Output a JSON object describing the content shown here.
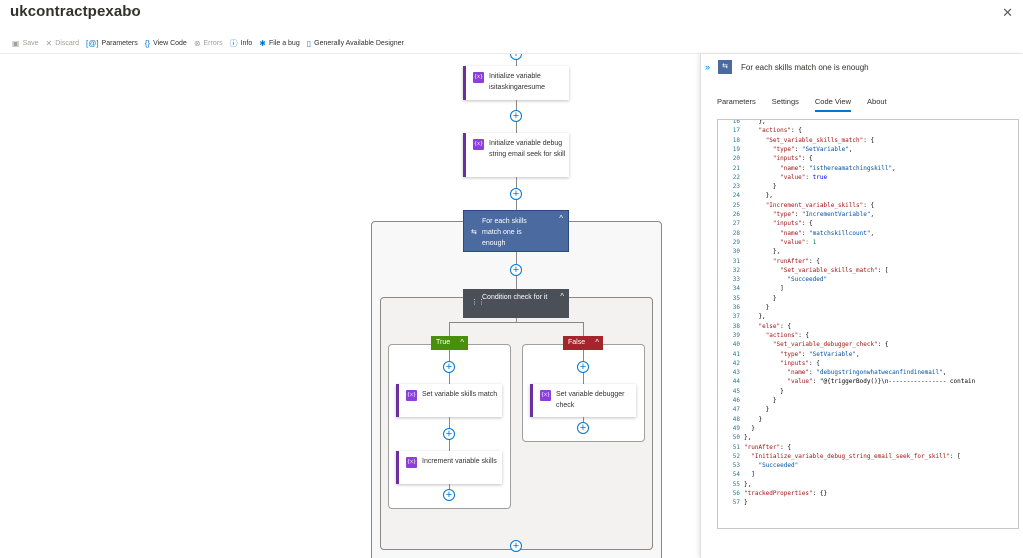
{
  "app": {
    "title": "ukcontractpexabo",
    "more": "···",
    "close": "✕"
  },
  "toolbar": {
    "items": [
      {
        "label": "Save",
        "icon": "save-icon",
        "glyph": "▣",
        "enabled": false
      },
      {
        "label": "Discard",
        "icon": "discard-icon",
        "glyph": "✕",
        "enabled": false
      },
      {
        "label": "Parameters",
        "icon": "parameters-icon",
        "glyph": "[@]",
        "enabled": true
      },
      {
        "label": "View Code",
        "icon": "code-icon",
        "glyph": "{}",
        "enabled": true
      },
      {
        "label": "Errors",
        "icon": "errors-icon",
        "glyph": "⊗",
        "enabled": false
      },
      {
        "label": "Info",
        "icon": "info-icon",
        "glyph": "ⓘ",
        "enabled": true
      },
      {
        "label": "File a bug",
        "icon": "bug-icon",
        "glyph": "✱",
        "enabled": true
      },
      {
        "label": "Generally Available Designer",
        "icon": "designer-icon",
        "glyph": "▯",
        "enabled": true
      }
    ]
  },
  "canvas": {
    "card_init_resume": "Initialize variable isitaskingaresume",
    "card_init_debug": "Initialize variable debug string email seek for skill",
    "foreach_label": "For each skills match one is enough",
    "condition_label": "Condition check for it",
    "true_label": "True",
    "false_label": "False",
    "card_set_skills": "Set variable skills match",
    "card_increment_skills": "Increment variable skills",
    "card_set_debugger": "Set variable debugger check",
    "var_icon_text": "{x}",
    "plus": "+",
    "chevron": "^",
    "colors": {
      "true": "#4a8f0a",
      "false": "#a4262c",
      "accent": "#0078d4",
      "variable": "#8c3fd9"
    }
  },
  "panel": {
    "collapse": "»",
    "title": "For each skills match one is enough",
    "tabs": [
      "Parameters",
      "Settings",
      "Code View",
      "About"
    ],
    "active_tab": "Code View",
    "code_lines": [
      {
        "n": "16",
        "t": "    },"
      },
      {
        "n": "17",
        "t": "    \"actions\": {"
      },
      {
        "n": "18",
        "t": "      \"Set_variable_skills_match\": {"
      },
      {
        "n": "19",
        "t": "        \"type\": \"SetVariable\","
      },
      {
        "n": "20",
        "t": "        \"inputs\": {"
      },
      {
        "n": "21",
        "t": "          \"name\": \"isthereamatchingskill\","
      },
      {
        "n": "22",
        "t": "          \"value\": true"
      },
      {
        "n": "23",
        "t": "        }"
      },
      {
        "n": "24",
        "t": "      },"
      },
      {
        "n": "25",
        "t": "      \"Increment_variable_skills\": {"
      },
      {
        "n": "26",
        "t": "        \"type\": \"IncrementVariable\","
      },
      {
        "n": "27",
        "t": "        \"inputs\": {"
      },
      {
        "n": "28",
        "t": "          \"name\": \"matchskillcount\","
      },
      {
        "n": "29",
        "t": "          \"value\": 1"
      },
      {
        "n": "30",
        "t": "        },"
      },
      {
        "n": "31",
        "t": "        \"runAfter\": {"
      },
      {
        "n": "32",
        "t": "          \"Set_variable_skills_match\": ["
      },
      {
        "n": "33",
        "t": "            \"Succeeded\""
      },
      {
        "n": "34",
        "t": "          ]"
      },
      {
        "n": "35",
        "t": "        }"
      },
      {
        "n": "36",
        "t": "      }"
      },
      {
        "n": "37",
        "t": "    },"
      },
      {
        "n": "38",
        "t": "    \"else\": {"
      },
      {
        "n": "39",
        "t": "      \"actions\": {"
      },
      {
        "n": "40",
        "t": "        \"Set_variable_debugger_check\": {"
      },
      {
        "n": "41",
        "t": "          \"type\": \"SetVariable\","
      },
      {
        "n": "42",
        "t": "          \"inputs\": {"
      },
      {
        "n": "43",
        "t": "            \"name\": \"debugstringonwhatwecanfindinemail\","
      },
      {
        "n": "44",
        "t": "            \"value\": \"@{triggerBody()}\\n---------------- contain"
      },
      {
        "n": "45",
        "t": "          }"
      },
      {
        "n": "46",
        "t": "        }"
      },
      {
        "n": "47",
        "t": "      }"
      },
      {
        "n": "48",
        "t": "    }"
      },
      {
        "n": "49",
        "t": "  }"
      },
      {
        "n": "50",
        "t": "},"
      },
      {
        "n": "51",
        "t": "\"runAfter\": {"
      },
      {
        "n": "52",
        "t": "  \"Initialize_variable_debug_string_email_seek_for_skill\": ["
      },
      {
        "n": "53",
        "t": "    \"Succeeded\""
      },
      {
        "n": "54",
        "t": "  ]"
      },
      {
        "n": "55",
        "t": "},"
      },
      {
        "n": "56",
        "t": "\"trackedProperties\": {}"
      },
      {
        "n": "57",
        "t": "}"
      }
    ]
  }
}
